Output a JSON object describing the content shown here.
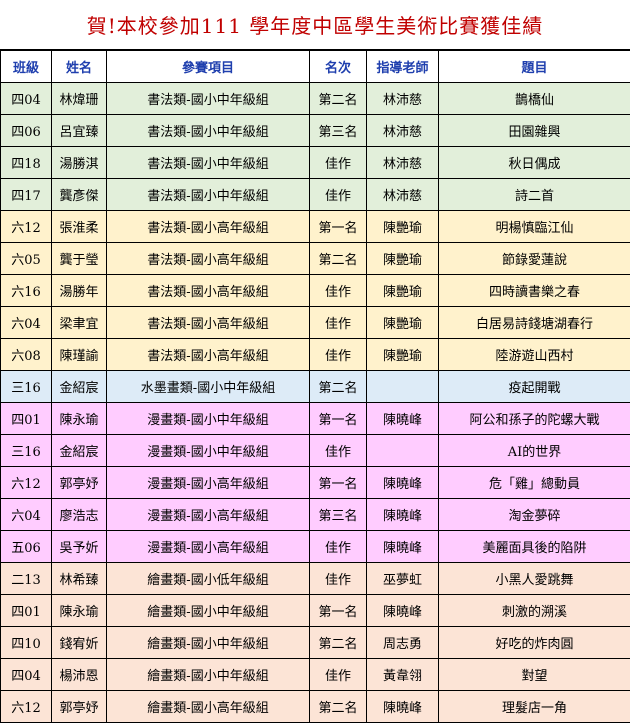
{
  "title": "賀!本校參加111 學年度中區學生美術比賽獲佳績",
  "headers": [
    "班級",
    "姓名",
    "參賽項目",
    "名次",
    "指導老師",
    "題目"
  ],
  "colors": {
    "green": "#e2efda",
    "yellow": "#fff2cc",
    "blue": "#ddebf7",
    "pink": "#ffccff",
    "peach": "#fce4d6",
    "title_red": "#c00000",
    "header_blue": "#1f3fae"
  },
  "rows": [
    {
      "cls": "四04",
      "name": "林煒珊",
      "item": "書法類-國小中年級組",
      "rank": "第二名",
      "teacher": "林沛慈",
      "topic": "鵲橋仙",
      "color": "green"
    },
    {
      "cls": "四06",
      "name": "呂宜臻",
      "item": "書法類-國小中年級組",
      "rank": "第三名",
      "teacher": "林沛慈",
      "topic": "田園雜興",
      "color": "green"
    },
    {
      "cls": "四18",
      "name": "湯勝淇",
      "item": "書法類-國小中年級組",
      "rank": "佳作",
      "teacher": "林沛慈",
      "topic": "秋日偶成",
      "color": "green"
    },
    {
      "cls": "四17",
      "name": "龔彥傑",
      "item": "書法類-國小中年級組",
      "rank": "佳作",
      "teacher": "林沛慈",
      "topic": "詩二首",
      "color": "green"
    },
    {
      "cls": "六12",
      "name": "張淮柔",
      "item": "書法類-國小高年級組",
      "rank": "第一名",
      "teacher": "陳艷瑜",
      "topic": "明楊慎臨江仙",
      "color": "yellow"
    },
    {
      "cls": "六05",
      "name": "龔于瑩",
      "item": "書法類-國小高年級組",
      "rank": "第二名",
      "teacher": "陳艷瑜",
      "topic": "節錄愛蓮說",
      "color": "yellow"
    },
    {
      "cls": "六16",
      "name": "湯勝年",
      "item": "書法類-國小高年級組",
      "rank": "佳作",
      "teacher": "陳艷瑜",
      "topic": "四時讀書樂之春",
      "color": "yellow"
    },
    {
      "cls": "六04",
      "name": "梁聿宜",
      "item": "書法類-國小高年級組",
      "rank": "佳作",
      "teacher": "陳艷瑜",
      "topic": "白居易詩錢塘湖春行",
      "color": "yellow"
    },
    {
      "cls": "六08",
      "name": "陳瑾諭",
      "item": "書法類-國小高年級組",
      "rank": "佳作",
      "teacher": "陳艷瑜",
      "topic": "陸游遊山西村",
      "color": "yellow"
    },
    {
      "cls": "三16",
      "name": "金紹宸",
      "item": "水墨畫類-國小中年級組",
      "rank": "第二名",
      "teacher": "",
      "topic": "疫起開戰",
      "color": "blue"
    },
    {
      "cls": "四01",
      "name": "陳永瑜",
      "item": "漫畫類-國小中年級組",
      "rank": "第一名",
      "teacher": "陳曉峰",
      "topic": "阿公和孫子的陀螺大戰",
      "color": "pink"
    },
    {
      "cls": "三16",
      "name": "金紹宸",
      "item": "漫畫類-國小中年級組",
      "rank": "佳作",
      "teacher": "",
      "topic": "AI的世界",
      "color": "pink"
    },
    {
      "cls": "六12",
      "name": "郭亭妤",
      "item": "漫畫類-國小高年級組",
      "rank": "第一名",
      "teacher": "陳曉峰",
      "topic": "危「雞」總動員",
      "color": "pink"
    },
    {
      "cls": "六04",
      "name": "廖浩志",
      "item": "漫畫類-國小高年級組",
      "rank": "第三名",
      "teacher": "陳曉峰",
      "topic": "淘金夢碎",
      "color": "pink"
    },
    {
      "cls": "五06",
      "name": "吳予妡",
      "item": "漫畫類-國小高年級組",
      "rank": "佳作",
      "teacher": "陳曉峰",
      "topic": "美麗面具後的陷阱",
      "color": "pink"
    },
    {
      "cls": "二13",
      "name": "林希臻",
      "item": "繪畫類-國小低年級組",
      "rank": "佳作",
      "teacher": "巫夢虹",
      "topic": "小黑人愛跳舞",
      "color": "peach"
    },
    {
      "cls": "四01",
      "name": "陳永瑜",
      "item": "繪畫類-國小中年級組",
      "rank": "第一名",
      "teacher": "陳曉峰",
      "topic": "刺激的溯溪",
      "color": "peach"
    },
    {
      "cls": "四10",
      "name": "錢宥妡",
      "item": "繪畫類-國小中年級組",
      "rank": "第二名",
      "teacher": "周志勇",
      "topic": "好吃的炸肉圓",
      "color": "peach"
    },
    {
      "cls": "四04",
      "name": "楊沛恩",
      "item": "繪畫類-國小中年級組",
      "rank": "佳作",
      "teacher": "黃韋翎",
      "topic": "對望",
      "color": "peach"
    },
    {
      "cls": "六12",
      "name": "郭亭妤",
      "item": "繪畫類-國小高年級組",
      "rank": "第二名",
      "teacher": "陳曉峰",
      "topic": "理髮店一角",
      "color": "peach"
    }
  ]
}
